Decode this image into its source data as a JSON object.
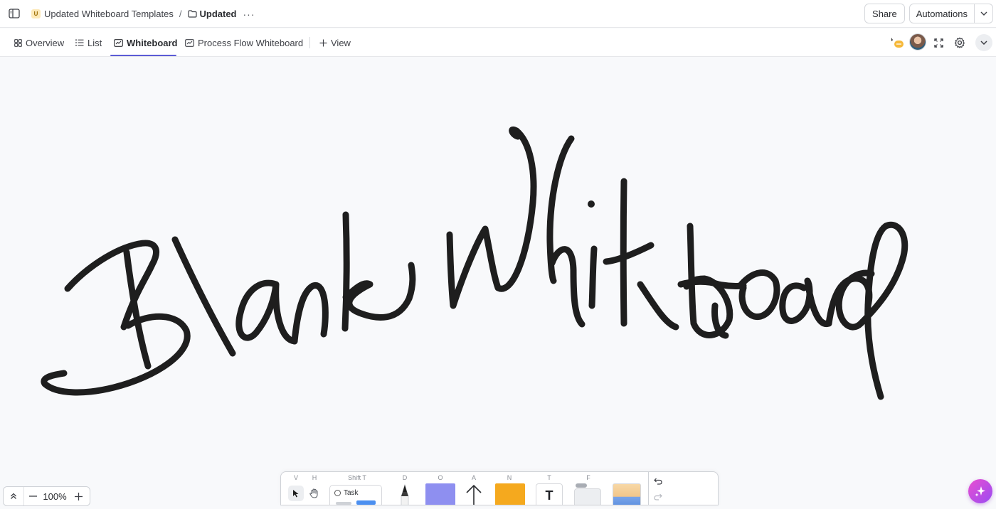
{
  "breadcrumb": {
    "space_badge": "U",
    "space_name": "Updated Whiteboard Templates",
    "separator": "/",
    "folder_name": "Updated",
    "more": "···"
  },
  "header_actions": {
    "share_label": "Share",
    "automations_label": "Automations"
  },
  "views": {
    "tabs": [
      {
        "label": "Overview",
        "icon": "overview-icon"
      },
      {
        "label": "List",
        "icon": "list-icon"
      },
      {
        "label": "Whiteboard",
        "icon": "whiteboard-icon",
        "active": true
      },
      {
        "label": "Process Flow Whiteboard",
        "icon": "whiteboard-icon"
      }
    ],
    "add_view_label": "View"
  },
  "canvas": {
    "handwriting_text": "Blank Whiteboard",
    "ink_color": "#1e1e1e"
  },
  "toolbar": {
    "keys": {
      "select": "V",
      "hand": "H",
      "task": "Shift T",
      "pen": "D",
      "shape": "O",
      "arrow": "A",
      "note": "N",
      "text": "T",
      "frame": "F"
    },
    "task_label": "Task",
    "text_glyph": "T",
    "shape_color": "#8e8ff0",
    "note_color": "#f5a91e"
  },
  "zoom": {
    "value": "100%"
  },
  "colors": {
    "accent": "#5b5bd6",
    "ai_gradient_start": "#e94fd0",
    "ai_gradient_end": "#9a4cf3"
  }
}
